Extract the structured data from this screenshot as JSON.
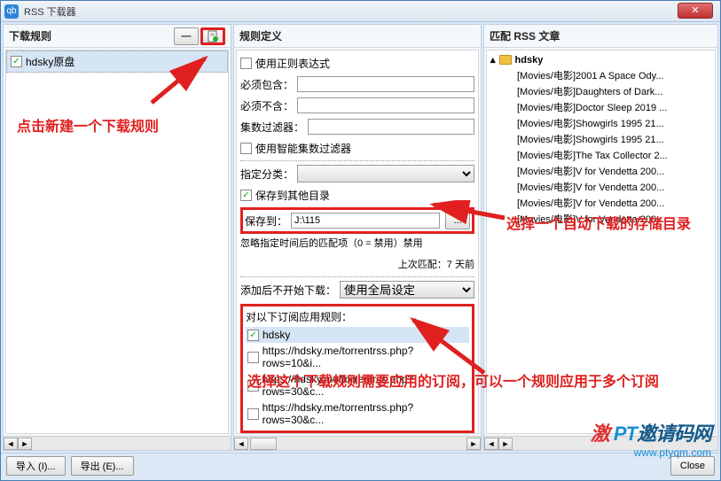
{
  "window": {
    "title": "RSS 下载器",
    "close": "✕"
  },
  "left": {
    "header": "下载规则",
    "rule_name": "hdsky原盘"
  },
  "mid": {
    "header": "规则定义",
    "use_regex": "使用正则表达式",
    "must_contain": "必须包含：",
    "must_not_contain": "必须不含：",
    "episode_filter": "集数过滤器：",
    "smart_filter": "使用智能集数过滤器",
    "category_label": "指定分类：",
    "save_other_dir": "保存到其他目录",
    "save_to_label": "保存到：",
    "save_to_value": "J:\\115",
    "ignore_label": "忽略指定时间后的匹配项（0 = 禁用）禁用",
    "last_match": "上次匹配：7 天前",
    "no_start_label": "添加后不开始下载：",
    "no_start_value": "使用全局设定",
    "apply_feeds_label": "对以下订阅应用规则：",
    "feeds": [
      {
        "name": "hdsky",
        "checked": true
      },
      {
        "name": "https://hdsky.me/torrentrss.php?rows=10&i...",
        "checked": false
      },
      {
        "name": "https://hdsky.me/torrentrss.php?rows=30&c...",
        "checked": false
      },
      {
        "name": "https://hdsky.me/torrentrss.php?rows=30&c...",
        "checked": false
      }
    ]
  },
  "right": {
    "header": "匹配 RSS 文章",
    "tree_root": "hdsky",
    "items": [
      "[Movies/电影]2001 A Space Ody...",
      "[Movies/电影]Daughters of Dark...",
      "[Movies/电影]Doctor Sleep 2019 ...",
      "[Movies/电影]Showgirls 1995 21...",
      "[Movies/电影]Showgirls 1995 21...",
      "[Movies/电影]The Tax Collector 2...",
      "[Movies/电影]V for Vendetta 200...",
      "[Movies/电影]V for Vendetta 200...",
      "[Movies/电影]V for Vendetta 200...",
      "[Movies/电影]V for Vendetta 200..."
    ]
  },
  "footer": {
    "import_btn": "导入 (I)...",
    "export_btn": "导出 (E)...",
    "close_btn": "Close"
  },
  "annotations": {
    "a1": "点击新建一个下载规则",
    "a2": "选择一个自动下载的存储目录",
    "a3": "选择这个下载规则需要应用的订阅，可以一个规则应用于多个订阅"
  },
  "watermark": {
    "brand_prefix": "PT",
    "brand_suffix": "邀请码网",
    "url": "www.ptyqm.com"
  }
}
